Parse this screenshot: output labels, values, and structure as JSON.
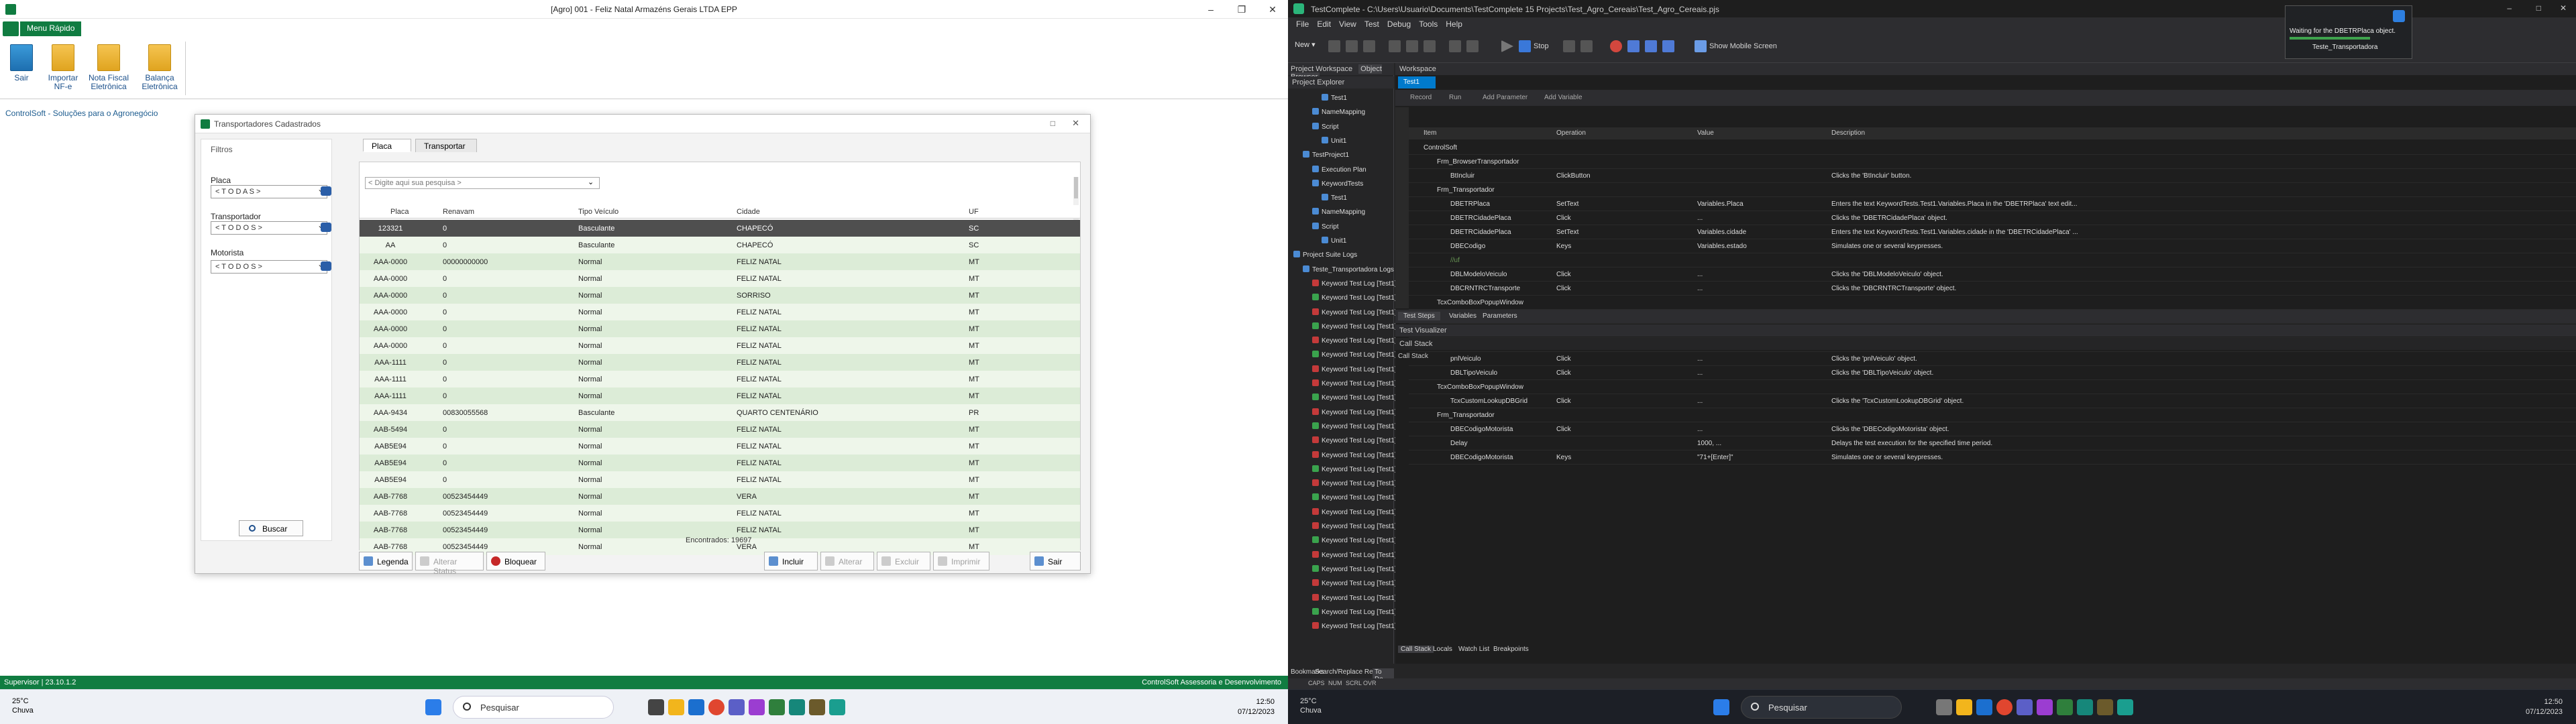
{
  "left": {
    "window_title": "[Agro] 001 - Feliz Natal Armazéns Gerais LTDA EPP",
    "ribbon": {
      "tab_active": "Menu Rápido",
      "buttons": [
        {
          "label": "Sair"
        },
        {
          "label": "Importar NF-e"
        },
        {
          "label": "Nota Fiscal Eletrônica"
        },
        {
          "label": "Balança Eletrônica"
        }
      ],
      "group_label": "ControlSoft - Soluções para o Agronegócio"
    },
    "dialog": {
      "title": "Transportadores Cadastrados",
      "filters_title": "Filtros",
      "filters": [
        {
          "label": "Placa",
          "value": "< T O D A S >"
        },
        {
          "label": "Transportador",
          "value": "< T O D O S >"
        },
        {
          "label": "Motorista",
          "value": "< T O D O S >"
        }
      ],
      "search_button": "Buscar",
      "tabs": [
        "Placa",
        "Transportar"
      ],
      "search_placeholder": "< Digite aqui sua pesquisa >",
      "columns": [
        "Placa",
        "Renavam",
        "Tipo Veículo",
        "Cidade",
        "UF"
      ],
      "rows": [
        [
          "123321",
          "0",
          "Basculante",
          "CHAPECÓ",
          "SC"
        ],
        [
          "AA",
          "0",
          "Basculante",
          "CHAPECÓ",
          "SC"
        ],
        [
          "AAA-0000",
          "00000000000",
          "Normal",
          "FELIZ NATAL",
          "MT"
        ],
        [
          "AAA-0000",
          "0",
          "Normal",
          "FELIZ NATAL",
          "MT"
        ],
        [
          "AAA-0000",
          "0",
          "Normal",
          "SORRISO",
          "MT"
        ],
        [
          "AAA-0000",
          "0",
          "Normal",
          "FELIZ NATAL",
          "MT"
        ],
        [
          "AAA-0000",
          "0",
          "Normal",
          "FELIZ NATAL",
          "MT"
        ],
        [
          "AAA-0000",
          "0",
          "Normal",
          "FELIZ NATAL",
          "MT"
        ],
        [
          "AAA-1111",
          "0",
          "Normal",
          "FELIZ NATAL",
          "MT"
        ],
        [
          "AAA-1111",
          "0",
          "Normal",
          "FELIZ NATAL",
          "MT"
        ],
        [
          "AAA-1111",
          "0",
          "Normal",
          "FELIZ NATAL",
          "MT"
        ],
        [
          "AAA-9434",
          "00830055568",
          "Basculante",
          "QUARTO CENTENÁRIO",
          "PR"
        ],
        [
          "AAB-5494",
          "0",
          "Normal",
          "FELIZ NATAL",
          "MT"
        ],
        [
          "AAB5E94",
          "0",
          "Normal",
          "FELIZ NATAL",
          "MT"
        ],
        [
          "AAB5E94",
          "0",
          "Normal",
          "FELIZ NATAL",
          "MT"
        ],
        [
          "AAB5E94",
          "0",
          "Normal",
          "FELIZ NATAL",
          "MT"
        ],
        [
          "AAB-7768",
          "00523454449",
          "Normal",
          "VERA",
          "MT"
        ],
        [
          "AAB-7768",
          "00523454449",
          "Normal",
          "FELIZ NATAL",
          "MT"
        ],
        [
          "AAB-7768",
          "00523454449",
          "Normal",
          "FELIZ NATAL",
          "MT"
        ],
        [
          "AAB-7768",
          "00523454449",
          "Normal",
          "VERA",
          "MT"
        ]
      ],
      "found_text": "Encontrados: 19697",
      "footer_buttons": [
        {
          "label": "Legenda",
          "enabled": true
        },
        {
          "label": "Alterar Status",
          "enabled": false
        },
        {
          "label": "Bloquear",
          "enabled": true
        },
        {
          "label": "Incluir",
          "enabled": true
        },
        {
          "label": "Alterar",
          "enabled": false
        },
        {
          "label": "Excluir",
          "enabled": false
        },
        {
          "label": "Imprimir",
          "enabled": false
        },
        {
          "label": "Sair",
          "enabled": true
        }
      ]
    },
    "statusbar": {
      "left": "Supervisor | 23.10.1.2",
      "right": "ControlSoft Assessoria e Desenvolvimento"
    },
    "taskbar": {
      "temp": "25°C",
      "weather": "Chuva",
      "search": "Pesquisar",
      "time": "12:50",
      "date": "07/12/2023"
    }
  },
  "right": {
    "window_title": "TestComplete - C:\\Users\\Usuario\\Documents\\TestComplete 15 Projects\\Test_Agro_Cereais\\Test_Agro_Cereais.pjs",
    "menu": [
      "File",
      "Edit",
      "View",
      "Test",
      "Debug",
      "Tools",
      "Help"
    ],
    "toolbar": {
      "new": "New",
      "stop": "Stop",
      "mobile": "Show Mobile Screen"
    },
    "panel_tabs": [
      "Project Workspace",
      "Object Browser"
    ],
    "project_explorer_title": "Project Explorer",
    "tree": [
      {
        "label": "Test1",
        "indent": 3,
        "color": "b"
      },
      {
        "label": "NameMapping",
        "indent": 2,
        "color": "b"
      },
      {
        "label": "Script",
        "indent": 2,
        "color": "b"
      },
      {
        "label": "Unit1",
        "indent": 3,
        "color": "b"
      },
      {
        "label": "TestProject1",
        "indent": 1,
        "color": "b"
      },
      {
        "label": "Execution Plan",
        "indent": 2,
        "color": "b"
      },
      {
        "label": "KeywordTests",
        "indent": 2,
        "color": "b"
      },
      {
        "label": "Test1",
        "indent": 3,
        "color": "b"
      },
      {
        "label": "NameMapping",
        "indent": 2,
        "color": "b"
      },
      {
        "label": "Script",
        "indent": 2,
        "color": "b"
      },
      {
        "label": "Unit1",
        "indent": 3,
        "color": "b"
      },
      {
        "label": "Project Suite Logs",
        "indent": 0,
        "color": "b"
      },
      {
        "label": "Teste_Transportadora Logs",
        "indent": 1,
        "color": "b"
      },
      {
        "label": "Keyword Test Log [Test1]",
        "indent": 2,
        "color": "r"
      },
      {
        "label": "Keyword Test Log [Test1]",
        "indent": 2,
        "color": "g"
      },
      {
        "label": "Keyword Test Log [Test1]",
        "indent": 2,
        "color": "r"
      },
      {
        "label": "Keyword Test Log [Test1]",
        "indent": 2,
        "color": "g"
      },
      {
        "label": "Keyword Test Log [Test1]",
        "indent": 2,
        "color": "r"
      },
      {
        "label": "Keyword Test Log [Test1]",
        "indent": 2,
        "color": "g"
      },
      {
        "label": "Keyword Test Log [Test1]",
        "indent": 2,
        "color": "r"
      },
      {
        "label": "Keyword Test Log [Test1]",
        "indent": 2,
        "color": "r"
      },
      {
        "label": "Keyword Test Log [Test1]",
        "indent": 2,
        "color": "g"
      },
      {
        "label": "Keyword Test Log [Test1]",
        "indent": 2,
        "color": "r"
      },
      {
        "label": "Keyword Test Log [Test1]",
        "indent": 2,
        "color": "g"
      },
      {
        "label": "Keyword Test Log [Test1]",
        "indent": 2,
        "color": "r"
      },
      {
        "label": "Keyword Test Log [Test1]",
        "indent": 2,
        "color": "r"
      },
      {
        "label": "Keyword Test Log [Test1]",
        "indent": 2,
        "color": "g"
      },
      {
        "label": "Keyword Test Log [Test1]",
        "indent": 2,
        "color": "r"
      },
      {
        "label": "Keyword Test Log [Test1]",
        "indent": 2,
        "color": "g"
      },
      {
        "label": "Keyword Test Log [Test1]",
        "indent": 2,
        "color": "r"
      },
      {
        "label": "Keyword Test Log [Test1]",
        "indent": 2,
        "color": "r"
      },
      {
        "label": "Keyword Test Log [Test1]",
        "indent": 2,
        "color": "g"
      },
      {
        "label": "Keyword Test Log [Test1]",
        "indent": 2,
        "color": "r"
      },
      {
        "label": "Keyword Test Log [Test1]",
        "indent": 2,
        "color": "g"
      },
      {
        "label": "Keyword Test Log [Test1]",
        "indent": 2,
        "color": "r"
      },
      {
        "label": "Keyword Test Log [Test1]",
        "indent": 2,
        "color": "r"
      },
      {
        "label": "Keyword Test Log [Test1]",
        "indent": 2,
        "color": "g"
      },
      {
        "label": "Keyword Test Log [Test1]",
        "indent": 2,
        "color": "r"
      }
    ],
    "workspace_title": "Workspace",
    "doc_tab": "Test1",
    "kw_toolbar": [
      "Record",
      "Run",
      "Add Parameter",
      "Add Variable"
    ],
    "kw_columns": [
      "Item",
      "Operation",
      "Value",
      "Description"
    ],
    "kw_rows": [
      {
        "i": 0,
        "item": "ControlSoft",
        "op": "",
        "val": "",
        "desc": ""
      },
      {
        "i": 1,
        "item": "Frm_BrowserTransportador",
        "op": "",
        "val": "",
        "desc": ""
      },
      {
        "i": 2,
        "item": "BtIncluir",
        "op": "ClickButton",
        "val": "",
        "desc": "Clicks the 'BtIncluir' button."
      },
      {
        "i": 1,
        "item": "Frm_Transportador",
        "op": "",
        "val": "",
        "desc": ""
      },
      {
        "i": 2,
        "item": "DBETRPlaca",
        "op": "SetText",
        "val": "Variables.Placa",
        "desc": "Enters the text KeywordTests.Test1.Variables.Placa in the 'DBETRPlaca' text edit..."
      },
      {
        "i": 2,
        "item": "DBETRCidadePlaca",
        "op": "Click",
        "val": "...",
        "desc": "Clicks the 'DBETRCidadePlaca' object."
      },
      {
        "i": 2,
        "item": "DBETRCidadePlaca",
        "op": "SetText",
        "val": "Variables.cidade",
        "desc": "Enters the text KeywordTests.Test1.Variables.cidade in the 'DBETRCidadePlaca' ..."
      },
      {
        "i": 2,
        "item": "DBECodigo",
        "op": "Keys",
        "val": "Variables.estado",
        "desc": "Simulates one or several keypresses."
      },
      {
        "i": 2,
        "item": "//uf",
        "op": "",
        "val": "",
        "desc": ""
      },
      {
        "i": 2,
        "item": "DBLModeloVeiculo",
        "op": "Click",
        "val": "...",
        "desc": "Clicks the 'DBLModeloVeiculo' object."
      },
      {
        "i": 2,
        "item": "DBCRNTRCTransporte",
        "op": "Click",
        "val": "...",
        "desc": "Clicks the 'DBCRNTRCTransporte' object."
      },
      {
        "i": 1,
        "item": "TcxComboBoxPopupWindow",
        "op": "",
        "val": "",
        "desc": ""
      },
      {
        "i": 2,
        "item": "TcxImageComboBoxListBox",
        "op": "Click",
        "val": "...",
        "desc": "Clicks the 'TcxImageComboBoxListBox' object."
      },
      {
        "i": 2,
        "item": "TcxCustomLookupDBGrid",
        "op": "Click",
        "val": "...",
        "desc": "Clicks the 'TcxCustomLookupDBGrid' object."
      },
      {
        "i": 1,
        "item": "Frm_Transportador",
        "op": "",
        "val": "",
        "desc": ""
      },
      {
        "i": 2,
        "item": "pnlVeiculo",
        "op": "Click",
        "val": "...",
        "desc": "Clicks the 'pnlVeiculo' object."
      },
      {
        "i": 2,
        "item": "DBLTipoVeiculo",
        "op": "Click",
        "val": "...",
        "desc": "Clicks the 'DBLTipoVeiculo' object."
      },
      {
        "i": 1,
        "item": "TcxComboBoxPopupWindow",
        "op": "",
        "val": "",
        "desc": ""
      },
      {
        "i": 2,
        "item": "TcxCustomLookupDBGrid",
        "op": "Click",
        "val": "...",
        "desc": "Clicks the 'TcxCustomLookupDBGrid' object."
      },
      {
        "i": 1,
        "item": "Frm_Transportador",
        "op": "",
        "val": "",
        "desc": ""
      },
      {
        "i": 2,
        "item": "DBECodigoMotorista",
        "op": "Click",
        "val": "...",
        "desc": "Clicks the 'DBECodigoMotorista' object."
      },
      {
        "i": 2,
        "item": "Delay",
        "op": "",
        "val": "1000, ...",
        "desc": "Delays the test execution for the specified time period."
      },
      {
        "i": 2,
        "item": "DBECodigoMotorista",
        "op": "Keys",
        "val": "\"71+[Enter]\"",
        "desc": "Simulates one or several keypresses."
      }
    ],
    "ws_bottom_tabs": [
      "Test Steps",
      "Variables",
      "Parameters"
    ],
    "visualizer_title": "Test Visualizer",
    "callstack_title": "Call Stack",
    "callstack_sub": "Call Stack",
    "dbg_tabs": [
      "Call Stack",
      "Locals",
      "Watch List",
      "Breakpoints"
    ],
    "left_bottom_tabs": [
      "Bookmarks",
      "Search/Replace Results",
      "To Do"
    ],
    "ide_status": [
      "CAPS",
      "NUM",
      "SCRL",
      "OVR"
    ],
    "popup": {
      "line1": "Waiting for the DBETRPlaca object.",
      "line2": "Teste_Transportadora"
    },
    "taskbar": {
      "temp": "25°C",
      "weather": "Chuva",
      "search": "Pesquisar",
      "time": "12:50",
      "date": "07/12/2023"
    }
  }
}
